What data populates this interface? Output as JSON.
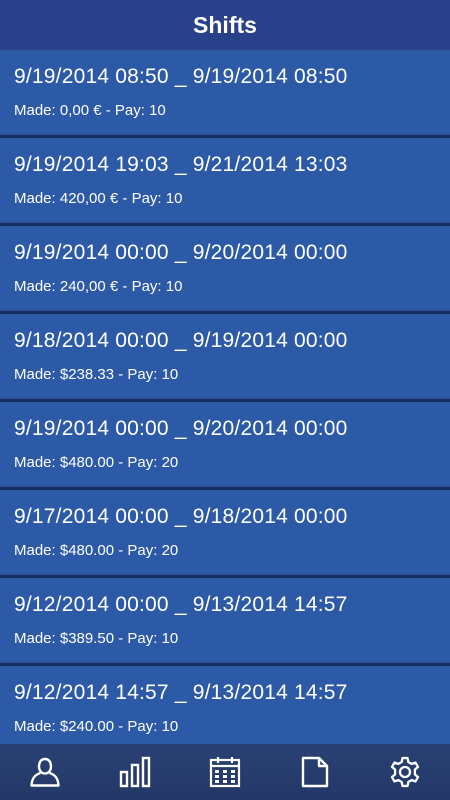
{
  "header": {
    "title": "Shifts"
  },
  "shifts": [
    {
      "range": "9/19/2014 08:50 _ 9/19/2014 08:50",
      "detail": "Made: 0,00 € - Pay: 10"
    },
    {
      "range": "9/19/2014 19:03 _ 9/21/2014 13:03",
      "detail": "Made: 420,00 € - Pay: 10"
    },
    {
      "range": "9/19/2014 00:00 _ 9/20/2014 00:00",
      "detail": "Made: 240,00 € - Pay: 10"
    },
    {
      "range": "9/18/2014 00:00 _ 9/19/2014 00:00",
      "detail": "Made: $238.33 - Pay: 10"
    },
    {
      "range": "9/19/2014 00:00 _ 9/20/2014 00:00",
      "detail": "Made: $480.00 - Pay: 20"
    },
    {
      "range": "9/17/2014 00:00 _ 9/18/2014 00:00",
      "detail": "Made: $480.00 - Pay: 20"
    },
    {
      "range": "9/12/2014 00:00 _ 9/13/2014 14:57",
      "detail": "Made: $389.50 - Pay: 10"
    },
    {
      "range": "9/12/2014 14:57 _ 9/13/2014 14:57",
      "detail": "Made: $240.00 - Pay: 10"
    }
  ],
  "tabbar": {
    "tabs": [
      {
        "icon": "person-icon"
      },
      {
        "icon": "bar-chart-icon"
      },
      {
        "icon": "calendar-icon"
      },
      {
        "icon": "document-icon"
      },
      {
        "icon": "gear-icon"
      }
    ],
    "icon_color": "#ffffff"
  },
  "colors": {
    "header_bg": "#29418a",
    "item_bg": "#2d5aa6",
    "tabbar_bg": "#28406f"
  }
}
